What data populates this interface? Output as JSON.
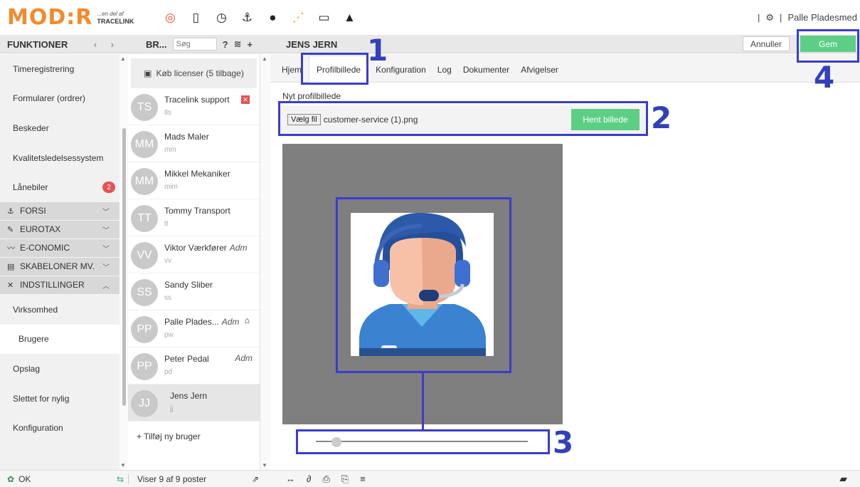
{
  "app": {
    "logo_text": "MOD:R",
    "logo_sub1": "...en del af",
    "logo_sub2": "TRACELINK",
    "user_name": "Palle Pladesmed"
  },
  "top_icons": [
    "lifebuoy-icon",
    "phone-icon",
    "clock-icon",
    "anchor-icon",
    "chat-icon",
    "flow-icon",
    "keyboard-icon",
    "warning-icon"
  ],
  "sidebar": {
    "title": "FUNKTIONER",
    "items": [
      {
        "label": "Timeregistrering"
      },
      {
        "label": "Formularer (ordrer)"
      },
      {
        "label": "Beskeder"
      },
      {
        "label": "Kvalitetsledelsessystem"
      },
      {
        "label": "Lånebiler",
        "badge": "2"
      }
    ],
    "groups": [
      {
        "label": "FORSI"
      },
      {
        "label": "EUROTAX"
      },
      {
        "label": "E-CONOMIC"
      },
      {
        "label": "SKABELONER MV."
      },
      {
        "label": "INDSTILLINGER"
      }
    ],
    "sub_items": [
      {
        "label": "Virksomhed"
      },
      {
        "label": "Brugere"
      },
      {
        "label": "Opslag"
      },
      {
        "label": "Slettet for nylig"
      },
      {
        "label": "Konfiguration"
      }
    ]
  },
  "userlist": {
    "title": "BR...",
    "search_placeholder": "Søg",
    "license_button": "Køb licenser (5 tilbage)",
    "users": [
      {
        "initials": "TS",
        "name": "Tracelink support",
        "login": "tls",
        "adm": ""
      },
      {
        "initials": "MM",
        "name": "Mads Maler",
        "login": "mm",
        "adm": ""
      },
      {
        "initials": "MM",
        "name": "Mikkel Mekaniker",
        "login": "mim",
        "adm": ""
      },
      {
        "initials": "TT",
        "name": "Tommy Transport",
        "login": "tt",
        "adm": ""
      },
      {
        "initials": "VV",
        "name": "Viktor Værkfører",
        "login": "vv",
        "adm": "Adm"
      },
      {
        "initials": "SS",
        "name": "Sandy Sliber",
        "login": "ss",
        "adm": ""
      },
      {
        "initials": "PP",
        "name": "Palle Plades...",
        "login": "pw",
        "adm": "Adm"
      },
      {
        "initials": "PP",
        "name": "Peter Pedal",
        "login": "pd",
        "adm": "Adm"
      },
      {
        "initials": "JJ",
        "name": "Jens Jern",
        "login": "jj",
        "adm": ""
      }
    ],
    "add_user": "+ Tilføj ny bruger"
  },
  "main": {
    "title": "JENS JERN",
    "cancel_label": "Annuller",
    "save_label": "Gem",
    "tabs": [
      "Hjem",
      "Profilbillede",
      "Konfiguration",
      "Log",
      "Dokumenter",
      "Afvigelser"
    ],
    "active_tab": "Profilbillede",
    "field_label": "Nyt profilbillede",
    "file_button": "Vælg fil",
    "file_name": "customer-service (1).png",
    "fetch_button": "Hent billede",
    "zoom_level": 0.1
  },
  "annotations": [
    "1",
    "2",
    "3",
    "4"
  ],
  "statusbar": {
    "ok_label": "OK",
    "count_label": "Viser 9 af 9 poster"
  },
  "colors": {
    "accent_green": "#5ccf85",
    "logo_orange": "#f28a2e",
    "annotation_blue": "#3c3ccc",
    "badge_red": "#e45454"
  }
}
